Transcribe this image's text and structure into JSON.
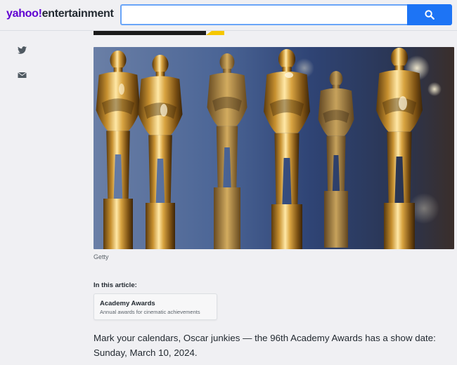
{
  "header": {
    "logo_brand": "yahoo",
    "logo_slash": "!",
    "logo_section": "entertainment",
    "search": {
      "value": "",
      "placeholder": ""
    },
    "search_button_icon": "search-icon"
  },
  "share": [
    {
      "icon": "twitter-icon"
    },
    {
      "icon": "mail-icon"
    }
  ],
  "hero": {
    "caption": "Getty"
  },
  "in_article": {
    "label": "In this article:",
    "topic_title": "Academy Awards",
    "topic_desc": "Annual awards for cinematic achievements"
  },
  "article": {
    "paragraph": "Mark your calendars, Oscar junkies — the 96th Academy Awards has a show date: Sunday, March 10, 2024."
  },
  "colors": {
    "brand_purple": "#6001d2",
    "search_blue": "#1d74f5",
    "page_bg": "#f0f0f3"
  }
}
